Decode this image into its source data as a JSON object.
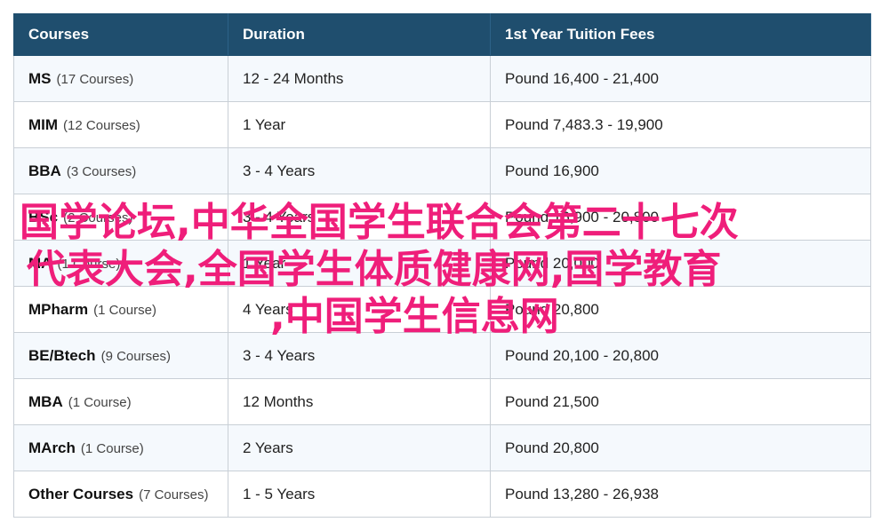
{
  "table": {
    "headers": [
      "Courses",
      "Duration",
      "1st Year Tuition Fees"
    ],
    "rows": [
      {
        "name": "MS",
        "count": "(17 Courses)",
        "duration": "12 - 24 Months",
        "fees": "Pound 16,400 - 21,400"
      },
      {
        "name": "MIM",
        "count": "(12 Courses)",
        "duration": "1 Year",
        "fees": "Pound 7,483.3 - 19,900"
      },
      {
        "name": "BBA",
        "count": "(3 Courses)",
        "duration": "3 - 4 Years",
        "fees": "Pound 16,900"
      },
      {
        "name": "BSc",
        "count": "(2 Courses)",
        "duration": "3 - 4 Years",
        "fees": "Pound 16,900 - 20,800"
      },
      {
        "name": "MA",
        "count": "(1 Course)",
        "duration": "1 Year",
        "fees": "Pound 20,000"
      },
      {
        "name": "MPharm",
        "count": "(1 Course)",
        "duration": "4 Years",
        "fees": "Pound 20,800"
      },
      {
        "name": "BE/Btech",
        "count": "(9 Courses)",
        "duration": "3 - 4 Years",
        "fees": "Pound 20,100 - 20,800"
      },
      {
        "name": "MBA",
        "count": "(1 Course)",
        "duration": "12 Months",
        "fees": "Pound 21,500"
      },
      {
        "name": "MArch",
        "count": "(1 Course)",
        "duration": "2 Years",
        "fees": "Pound 20,800"
      },
      {
        "name": "Other Courses",
        "count": "(7 Courses)",
        "duration": "1 - 5 Years",
        "fees": "Pound 13,280 - 26,938"
      }
    ]
  },
  "overlay": {
    "line1": "国学论坛,中华全国学生联合会第二十七次",
    "line2": "代表大会,全国学生体质健康网,国学教育",
    "line3": ",中国学生信息网",
    "color": "#ef1e7a"
  },
  "colors": {
    "header_bg": "#1f4e6e",
    "row_alt": "#f5f9fd",
    "border": "#c9cfd6"
  }
}
